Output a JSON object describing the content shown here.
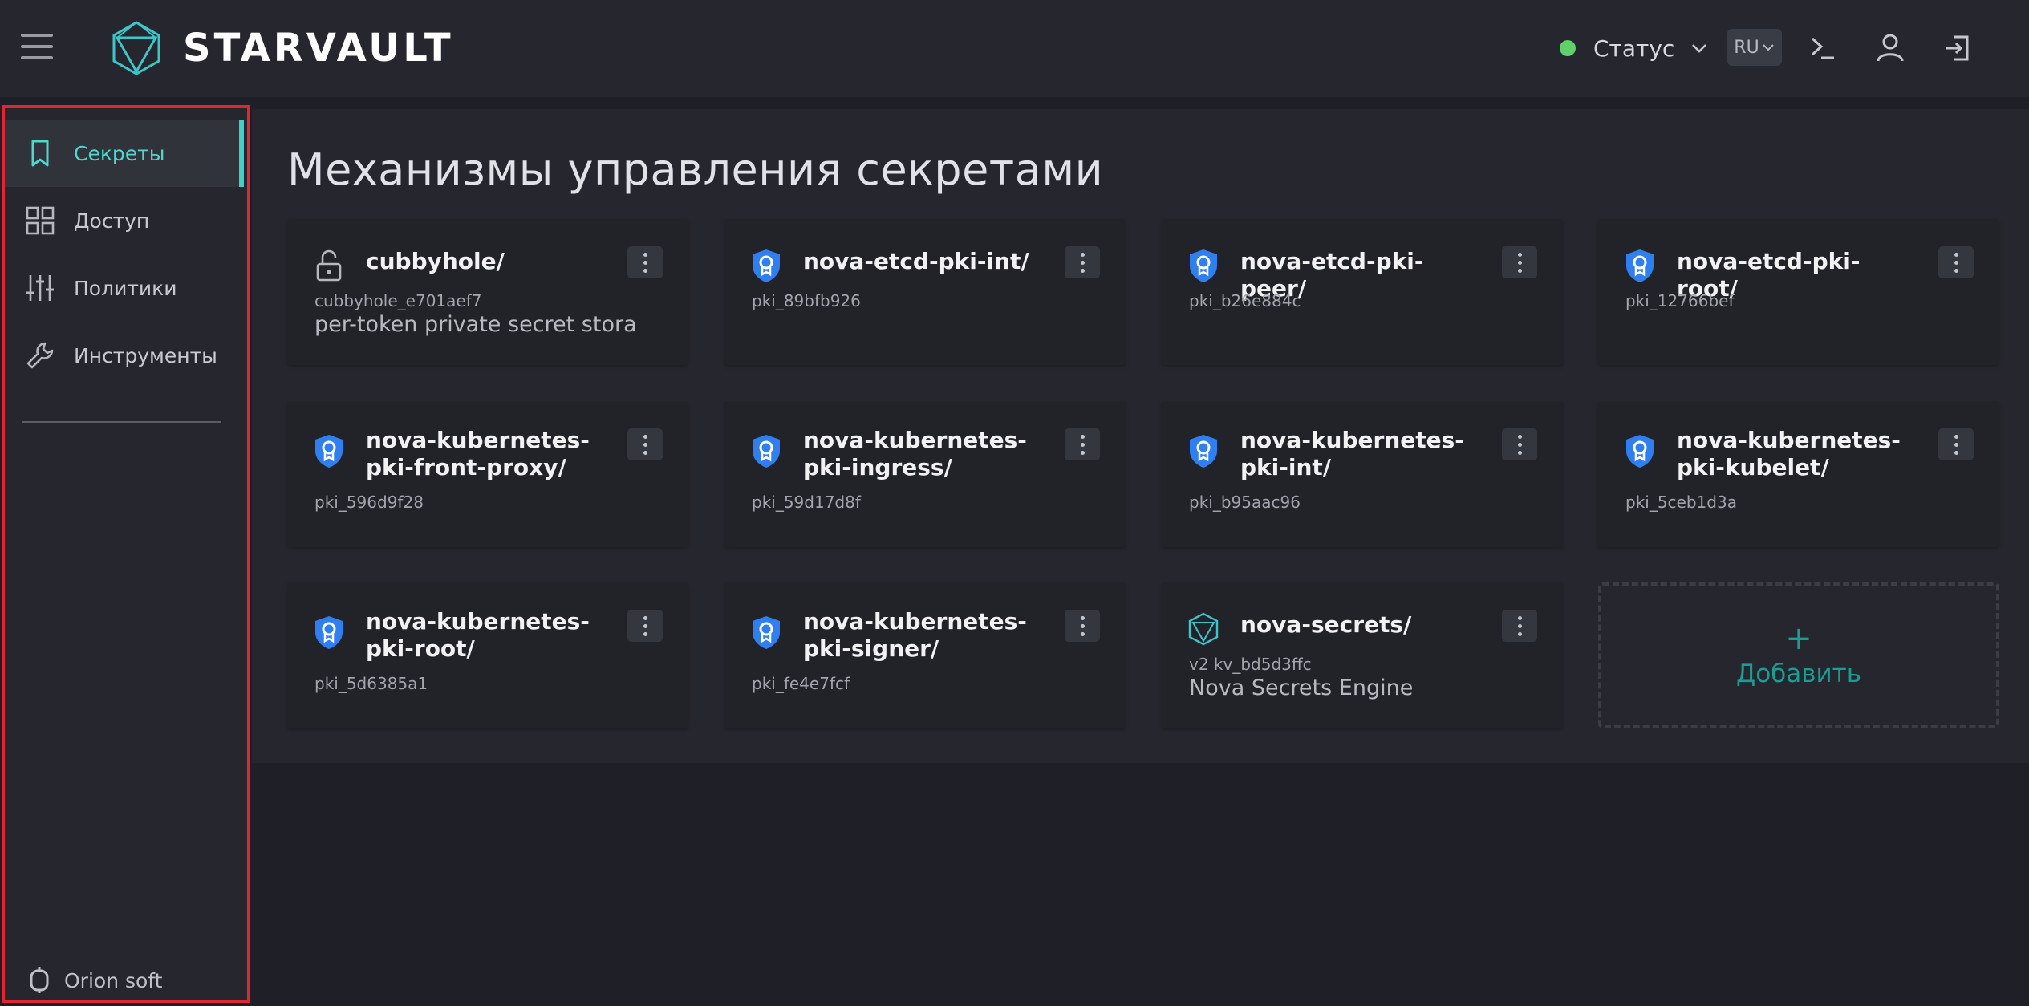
{
  "header": {
    "brand": "STARVAULT",
    "status_label": "Статус",
    "status_color": "#5fd06a",
    "language": "RU",
    "icons": [
      "menu-icon",
      "logo-icon",
      "chevron-down-icon",
      "terminal-icon",
      "user-icon",
      "logout-icon"
    ]
  },
  "sidebar": {
    "items": [
      {
        "label": "Секреты",
        "icon": "bookmark-icon",
        "active": true
      },
      {
        "label": "Доступ",
        "icon": "grid-icon",
        "active": false
      },
      {
        "label": "Политики",
        "icon": "sliders-icon",
        "active": false
      },
      {
        "label": "Инструменты",
        "icon": "wrench-icon",
        "active": false
      }
    ],
    "footer": "Orion soft",
    "accent_color": "#3cd1c9"
  },
  "main": {
    "title": "Механизмы управления секретами",
    "cards": [
      {
        "title": "cubbyhole/",
        "sub": "cubbyhole_e701aef7",
        "desc": "per-token private secret storage",
        "icon": "unlock-icon"
      },
      {
        "title": "nova-etcd-pki-int/",
        "sub": "pki_89bfb926",
        "desc": "",
        "icon": "certificate-badge-icon"
      },
      {
        "title": "nova-etcd-pki-peer/",
        "sub": "pki_b26e884c",
        "desc": "",
        "icon": "certificate-badge-icon"
      },
      {
        "title": "nova-etcd-pki-root/",
        "sub": "pki_12766bef",
        "desc": "",
        "icon": "certificate-badge-icon"
      },
      {
        "title": "nova-kubernetes-pki-front-proxy/",
        "sub": "pki_596d9f28",
        "desc": "",
        "icon": "certificate-badge-icon"
      },
      {
        "title": "nova-kubernetes-pki-ingress/",
        "sub": "pki_59d17d8f",
        "desc": "",
        "icon": "certificate-badge-icon"
      },
      {
        "title": "nova-kubernetes-pki-int/",
        "sub": "pki_b95aac96",
        "desc": "",
        "icon": "certificate-badge-icon"
      },
      {
        "title": "nova-kubernetes-pki-kubelet/",
        "sub": "pki_5ceb1d3a",
        "desc": "",
        "icon": "certificate-badge-icon"
      },
      {
        "title": "nova-kubernetes-pki-root/",
        "sub": "pki_5d6385a1",
        "desc": "",
        "icon": "certificate-badge-icon"
      },
      {
        "title": "nova-kubernetes-pki-signer/",
        "sub": "pki_fe4e7fcf",
        "desc": "",
        "icon": "certificate-badge-icon"
      },
      {
        "title": "nova-secrets/",
        "sub": "v2 kv_bd5d3ffc",
        "desc": "Nova Secrets Engine",
        "icon": "kv-engine-icon"
      }
    ],
    "add_symbol": "+",
    "add_label": "Добавить",
    "add_color": "#1b9c94"
  }
}
